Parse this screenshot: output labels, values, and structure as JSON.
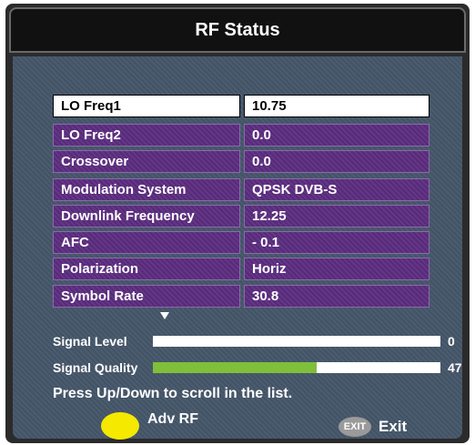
{
  "window": {
    "title": "RF Status"
  },
  "rows": [
    {
      "label": "LO Freq1",
      "value": "10.75"
    },
    {
      "label": "LO Freq2",
      "value": "0.0"
    },
    {
      "label": "Crossover",
      "value": "0.0"
    },
    {
      "label": "Modulation System",
      "value": "QPSK DVB-S"
    },
    {
      "label": "Downlink Frequency",
      "value": "12.25"
    },
    {
      "label": "AFC",
      "value": "- 0.1"
    },
    {
      "label": "Polarization",
      "value": "Horiz"
    },
    {
      "label": "Symbol Rate",
      "value": "30.8"
    }
  ],
  "selected_row": 0,
  "meters": {
    "signal_level": {
      "label": "Signal Level",
      "value": "0",
      "percent": 0
    },
    "signal_quality": {
      "label": "Signal Quality",
      "value": "47",
      "percent": 57
    }
  },
  "hint": "Press Up/Down to scroll in the list.",
  "footer": {
    "adv_rf_label": "Adv RF",
    "exit_key_label": "EXIT",
    "exit_label": "Exit"
  },
  "colors": {
    "row_bg": "#5c2c80",
    "selected_bg": "#ffffff",
    "panel_bg": "#45566a",
    "quality_fill": "#7fbf3a",
    "yellow_button": "#f5e900"
  }
}
